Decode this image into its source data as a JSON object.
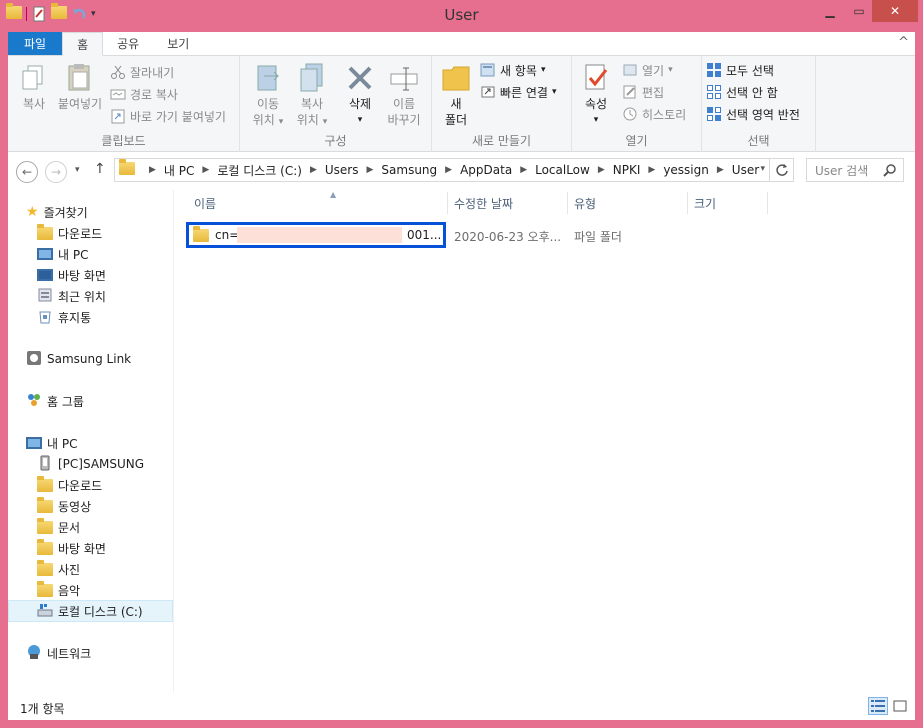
{
  "window": {
    "title": "User"
  },
  "ribbon_tabs": {
    "file": "파일",
    "home": "홈",
    "share": "공유",
    "view": "보기"
  },
  "ribbon": {
    "clipboard": {
      "label": "클립보드",
      "copy": "복사",
      "paste": "붙여넣기",
      "cut": "잘라내기",
      "copy_path": "경로 복사",
      "paste_shortcut": "바로 가기 붙여넣기"
    },
    "organize": {
      "label": "구성",
      "move_to_1": "이동",
      "move_to_2": "위치",
      "copy_to_1": "복사",
      "copy_to_2": "위치",
      "delete": "삭제",
      "rename_1": "이름",
      "rename_2": "바꾸기"
    },
    "new": {
      "label": "새로 만들기",
      "new_folder_1": "새",
      "new_folder_2": "폴더",
      "new_item": "새 항목",
      "easy_access": "빠른 연결"
    },
    "open": {
      "label": "열기",
      "properties": "속성",
      "open": "열기",
      "edit": "편집",
      "history": "히스토리"
    },
    "select": {
      "label": "선택",
      "select_all": "모두 선택",
      "select_none": "선택 안 함",
      "invert": "선택 영역 반전"
    }
  },
  "address": {
    "crumbs": [
      "내 PC",
      "로컬 디스크 (C:)",
      "Users",
      "Samsung",
      "AppData",
      "LocalLow",
      "NPKI",
      "yessign",
      "User"
    ],
    "search_placeholder": "User 검색"
  },
  "nav": {
    "favorites": "즐겨찾기",
    "downloads": "다운로드",
    "this_pc_fav": "내 PC",
    "desktop": "바탕 화면",
    "recent": "최근 위치",
    "recycle": "휴지통",
    "samsung_link": "Samsung Link",
    "homegroup": "홈 그룹",
    "this_pc": "내 PC",
    "pc_samsung": "[PC]SAMSUNG",
    "pc_downloads": "다운로드",
    "videos": "동영상",
    "documents": "문서",
    "pc_desktop": "바탕 화면",
    "pictures": "사진",
    "music": "음악",
    "local_disk": "로컬 디스크 (C:)",
    "network": "네트워크"
  },
  "columns": {
    "name": "이름",
    "date": "수정한 날짜",
    "type": "유형",
    "size": "크기"
  },
  "files": [
    {
      "name_prefix": "cn=",
      "name_suffix": "001...",
      "date": "2020-06-23 오후...",
      "type": "파일 폴더"
    }
  ],
  "status": {
    "count": "1개 항목"
  },
  "colors": {
    "frame": "#e66f8f",
    "file_tab": "#1979ca",
    "selection_border": "#0751d8",
    "redaction": "#fde1d8"
  }
}
